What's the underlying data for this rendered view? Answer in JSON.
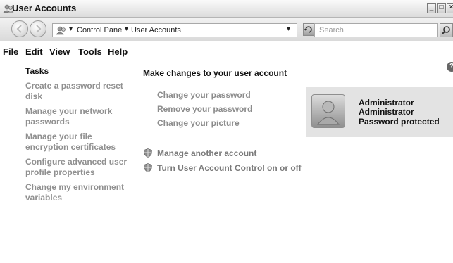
{
  "window": {
    "title": "User Accounts",
    "icon": "user-accounts-icon",
    "minimize_label": "_",
    "maximize_label": "□",
    "close_label": "×"
  },
  "address": {
    "crumbs": [
      "Control Panel",
      "User Accounts"
    ],
    "separator_glyph": "▾",
    "dropdown_glyph": "▾",
    "search_placeholder": "Search"
  },
  "menu": [
    "File",
    "Edit",
    "View",
    "Tools",
    "Help"
  ],
  "help_glyph": "?",
  "tasks": {
    "heading": "Tasks",
    "items": [
      "Create a password reset disk",
      "Manage your network passwords",
      "Manage your file encryption certificates",
      "Configure advanced user profile properties",
      "Change my environment variables"
    ]
  },
  "main": {
    "heading": "Make changes to your user account",
    "actions": [
      "Change your password",
      "Remove your password",
      "Change your picture"
    ],
    "shield_actions": [
      "Manage another account",
      "Turn User Account Control on or off"
    ]
  },
  "account": {
    "name": "Administrator",
    "type": "Administrator",
    "status": "Password protected"
  },
  "colors": {
    "link_gray": "#8c8c8c",
    "card_bg": "#e3e3e3"
  }
}
